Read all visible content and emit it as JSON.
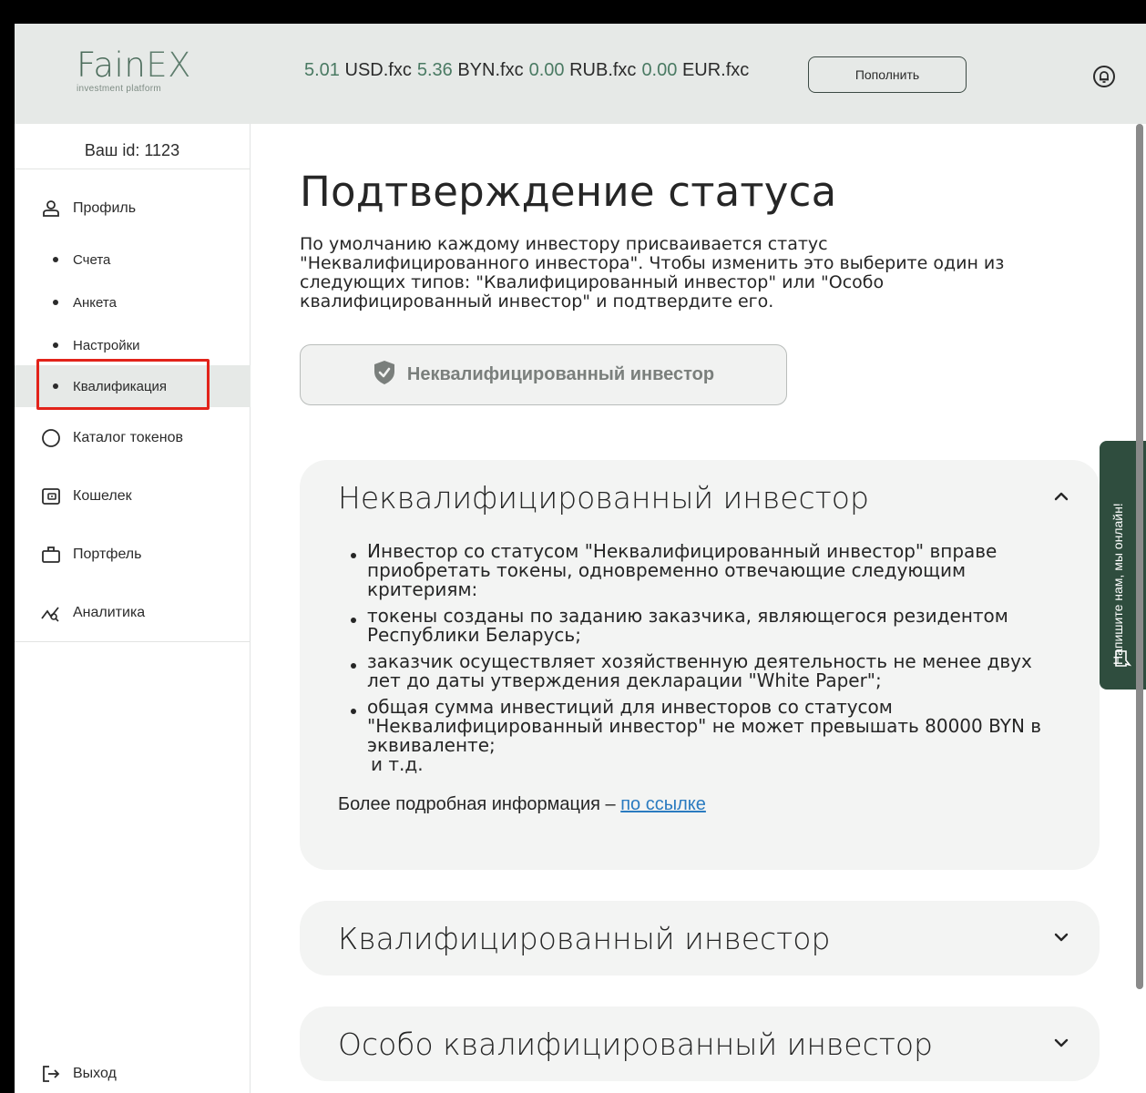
{
  "header": {
    "logo_main": "Fain",
    "logo_ex": "EX",
    "logo_sub": "investment platform",
    "balances": [
      {
        "value": "5.01",
        "currency": "USD.fxc"
      },
      {
        "value": "5.36",
        "currency": "BYN.fxc"
      },
      {
        "value": "0.00",
        "currency": "RUB.fxc"
      },
      {
        "value": "0.00",
        "currency": "EUR.fxc"
      }
    ],
    "topup_label": "Пополнить",
    "notif_icon": "bell-icon"
  },
  "sidebar": {
    "user_id": "Ваш id: 1123",
    "profile": "Профиль",
    "sub_items": [
      "Счета",
      "Анкета",
      "Настройки",
      "Квалификация"
    ],
    "catalog": "Каталог токенов",
    "wallet": "Кошелек",
    "portfolio": "Портфель",
    "analytics": "Аналитика",
    "logout": "Выход"
  },
  "main": {
    "title": "Подтверждение статуса",
    "intro": "По умолчанию каждому инвестору присваивается статус \"Неквалифицированного инвестора\". Чтобы изменить это выберите один из следующих типов: \"Квалифицированный инвестор\" или \"Особо квалифицированный инвестор\" и подтвердите его.",
    "status_button": "Неквалифицированный инвестор",
    "accordion": [
      {
        "title": "Неквалифицированный инвестор",
        "expanded": true,
        "bullets": [
          "Инвестор со статусом \"Неквалифицированный инвестор\" вправе приобретать токены, одновременно отвечающие следующим критериям:",
          "токены созданы по заданию заказчика, являющегося резидентом Республики Беларусь;",
          "заказчик осуществляет хозяйственную деятельность не менее двух лет до даты утверждения декларации \"White Paper\";",
          "общая сумма инвестиций для инвесторов со статусом \"Неквалифицированный инвестор\" не может превышать 80000 BYN в эквиваленте;"
        ],
        "etc": "и т.д.",
        "more_text": "Более подробная информация – ",
        "more_link": "по ссылке"
      },
      {
        "title": "Квалифицированный инвестор",
        "expanded": false
      },
      {
        "title": "Особо квалифицированный инвестор",
        "expanded": false
      }
    ]
  },
  "chat_tab": "Напишите нам, мы онлайн!",
  "colors": {
    "accent": "#4a7a63",
    "header_bg": "#e6e9e7",
    "chat_bg": "#2f4d3e",
    "link": "#2a7bc0",
    "highlight": "#e2231a"
  }
}
